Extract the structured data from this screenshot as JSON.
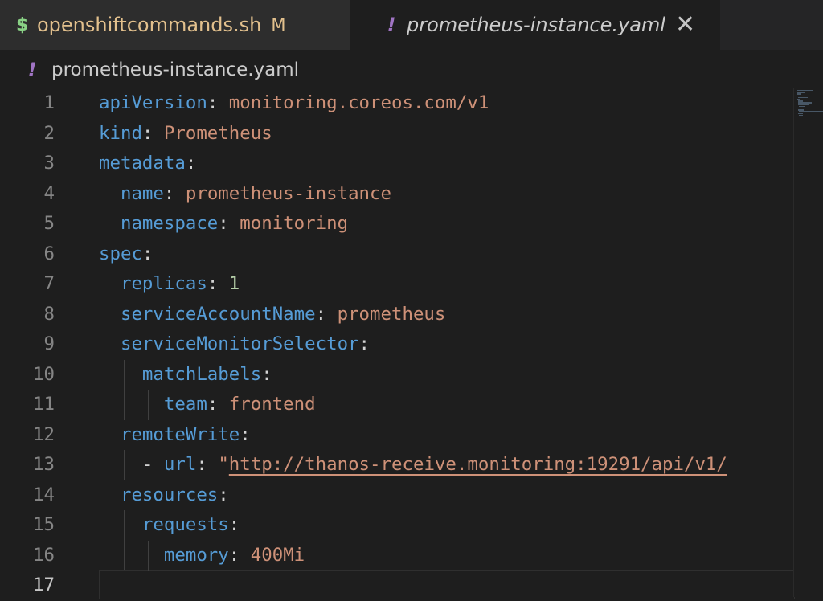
{
  "tabs": [
    {
      "icon": "$",
      "name": "openshiftcommands.sh",
      "status": "M"
    },
    {
      "icon": "!",
      "name": "prometheus-instance.yaml",
      "close": "✕"
    }
  ],
  "breadcrumb": {
    "icon": "!",
    "label": "prometheus-instance.yaml"
  },
  "editor": {
    "current_line": 17,
    "lines": [
      {
        "num": "1",
        "tokens": [
          [
            "k",
            "apiVersion"
          ],
          [
            "p",
            ": "
          ],
          [
            "s",
            "monitoring.coreos.com/v1"
          ]
        ]
      },
      {
        "num": "2",
        "tokens": [
          [
            "k",
            "kind"
          ],
          [
            "p",
            ": "
          ],
          [
            "s",
            "Prometheus"
          ]
        ]
      },
      {
        "num": "3",
        "tokens": [
          [
            "k",
            "metadata"
          ],
          [
            "p",
            ":"
          ]
        ]
      },
      {
        "num": "4",
        "tokens": [
          [
            "p",
            "  "
          ],
          [
            "k",
            "name"
          ],
          [
            "p",
            ": "
          ],
          [
            "s",
            "prometheus-instance"
          ]
        ]
      },
      {
        "num": "5",
        "tokens": [
          [
            "p",
            "  "
          ],
          [
            "k",
            "namespace"
          ],
          [
            "p",
            ": "
          ],
          [
            "s",
            "monitoring"
          ]
        ]
      },
      {
        "num": "6",
        "tokens": [
          [
            "k",
            "spec"
          ],
          [
            "p",
            ":"
          ]
        ]
      },
      {
        "num": "7",
        "tokens": [
          [
            "p",
            "  "
          ],
          [
            "k",
            "replicas"
          ],
          [
            "p",
            ": "
          ],
          [
            "n",
            "1"
          ]
        ]
      },
      {
        "num": "8",
        "tokens": [
          [
            "p",
            "  "
          ],
          [
            "k",
            "serviceAccountName"
          ],
          [
            "p",
            ": "
          ],
          [
            "s",
            "prometheus"
          ]
        ]
      },
      {
        "num": "9",
        "tokens": [
          [
            "p",
            "  "
          ],
          [
            "k",
            "serviceMonitorSelector"
          ],
          [
            "p",
            ":"
          ]
        ]
      },
      {
        "num": "10",
        "tokens": [
          [
            "p",
            "    "
          ],
          [
            "k",
            "matchLabels"
          ],
          [
            "p",
            ":"
          ]
        ]
      },
      {
        "num": "11",
        "tokens": [
          [
            "p",
            "      "
          ],
          [
            "k",
            "team"
          ],
          [
            "p",
            ": "
          ],
          [
            "s",
            "frontend"
          ]
        ]
      },
      {
        "num": "12",
        "tokens": [
          [
            "p",
            "  "
          ],
          [
            "k",
            "remoteWrite"
          ],
          [
            "p",
            ":"
          ]
        ]
      },
      {
        "num": "13",
        "tokens": [
          [
            "p",
            "    - "
          ],
          [
            "k",
            "url"
          ],
          [
            "p",
            ": "
          ],
          [
            "s",
            "\""
          ],
          [
            "u",
            "http://thanos-receive.monitoring:19291/api/v1/"
          ]
        ]
      },
      {
        "num": "14",
        "tokens": [
          [
            "p",
            "  "
          ],
          [
            "k",
            "resources"
          ],
          [
            "p",
            ":"
          ]
        ]
      },
      {
        "num": "15",
        "tokens": [
          [
            "p",
            "    "
          ],
          [
            "k",
            "requests"
          ],
          [
            "p",
            ":"
          ]
        ]
      },
      {
        "num": "16",
        "tokens": [
          [
            "p",
            "      "
          ],
          [
            "k",
            "memory"
          ],
          [
            "p",
            ": "
          ],
          [
            "s",
            "400Mi"
          ]
        ]
      },
      {
        "num": "17",
        "tokens": []
      }
    ]
  },
  "colors": {
    "key": "#569cd6",
    "string": "#ce9178",
    "number": "#b5cea8",
    "background": "#1e1e1e",
    "shell_icon": "#89d185",
    "yaml_icon": "#a074c4",
    "modified": "#e2c08d"
  }
}
